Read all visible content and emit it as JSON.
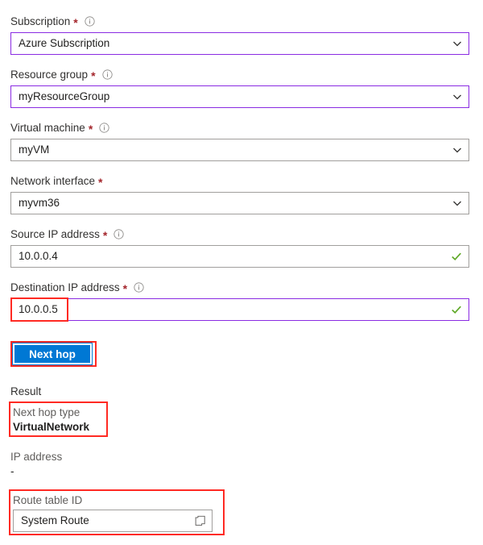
{
  "form": {
    "fields": [
      {
        "label": "Subscription",
        "required": true,
        "info": true,
        "info_icon": "info-circle-icon",
        "value": "Azure Subscription",
        "control": "dropdown",
        "border": "purple",
        "trailing_icon": "chevron-down-icon"
      },
      {
        "label": "Resource group",
        "required": true,
        "info": true,
        "info_icon": "info-circle-icon",
        "value": "myResourceGroup",
        "control": "dropdown",
        "border": "purple",
        "trailing_icon": "chevron-down-icon"
      },
      {
        "label": "Virtual machine",
        "required": true,
        "info": true,
        "info_icon": "info-circle-icon",
        "value": "myVM",
        "control": "dropdown",
        "border": "gray",
        "trailing_icon": "chevron-down-icon"
      },
      {
        "label": "Network interface",
        "required": true,
        "info": false,
        "info_icon": "",
        "value": "myvm36",
        "control": "dropdown",
        "border": "gray",
        "trailing_icon": "chevron-down-icon"
      },
      {
        "label": "Source IP address",
        "required": true,
        "info": true,
        "info_icon": "info-circle-icon",
        "value": "10.0.0.4",
        "control": "textbox",
        "border": "gray",
        "trailing_icon": "valid-checkmark-icon"
      },
      {
        "label": "Destination IP address",
        "required": true,
        "info": true,
        "info_icon": "info-circle-icon",
        "value": "10.0.0.5",
        "control": "textbox",
        "border": "purple",
        "trailing_icon": "valid-checkmark-icon"
      }
    ],
    "required_marker": "*"
  },
  "action": {
    "next_hop_label": "Next hop"
  },
  "result": {
    "title": "Result",
    "next_hop_type_label": "Next hop type",
    "next_hop_type_value": "VirtualNetwork",
    "ip_address_label": "IP address",
    "ip_address_value": "-",
    "route_table_id_label": "Route table ID",
    "route_table_id_value": "System Route",
    "copy_icon": "copy-icon"
  },
  "colors": {
    "accent_blue": "#0078d4",
    "focus_purple": "#8a2be2",
    "annotation_red": "#ff2a23",
    "required_red": "#a4262c",
    "valid_green": "#5ea826",
    "border_gray": "#a19f9d",
    "label_gray": "#605e5c"
  }
}
